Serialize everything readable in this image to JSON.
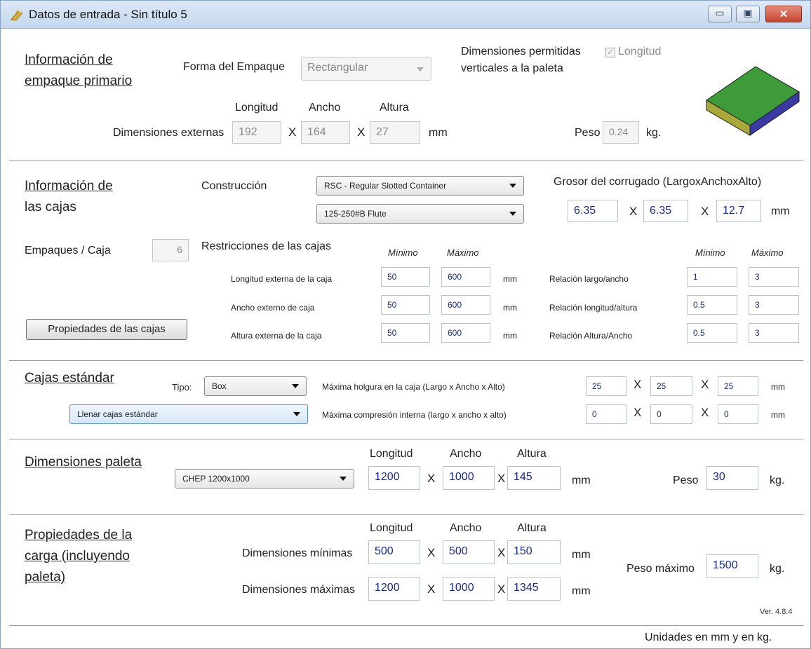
{
  "window": {
    "title": "Datos de entrada - Sin título 5",
    "controls": {
      "minimize": "▭",
      "maximize": "▣",
      "close": "✕"
    }
  },
  "primary": {
    "title_line1": "Información de",
    "title_line2": "empaque primario",
    "shape_label": "Forma del Empaque",
    "shape_value": "Rectangular",
    "vertical_label_1": "Dimensiones permitidas",
    "vertical_label_2": "verticales a la paleta",
    "check_label": "Longitud",
    "check_mark": "✓",
    "col_length": "Longitud",
    "col_width": "Ancho",
    "col_height": "Altura",
    "dims_label": "Dimensiones externas",
    "length": "192",
    "width": "164",
    "height": "27",
    "x": "X",
    "unit_mm": "mm",
    "weight_label": "Peso",
    "weight": "0.24",
    "unit_kg": "kg."
  },
  "boxes": {
    "title_line1": "Información de",
    "title_line2": "las cajas",
    "construction_label": "Construcción",
    "construction_value": "RSC - Regular Slotted Container",
    "flute_value": "125-250#B Flute",
    "thickness_label": "Grosor del corrugado (LargoxAnchoxAlto)",
    "thickness": [
      "6.35",
      "6.35",
      "12.7"
    ],
    "x": "X",
    "unit_mm": "mm",
    "packs_label": "Empaques / Caja",
    "packs_value": "6",
    "restrictions_label": "Restricciones de las cajas",
    "min_label": "Mínimo",
    "max_label": "Máximo",
    "rows": [
      {
        "label": "Longitud externa de la caja",
        "min": "50",
        "max": "600",
        "unit": "mm"
      },
      {
        "label": "Ancho externo de caja",
        "min": "50",
        "max": "600",
        "unit": "mm"
      },
      {
        "label": "Altura externa de la caja",
        "min": "50",
        "max": "600",
        "unit": "mm"
      }
    ],
    "ratios": [
      {
        "label": "Relación largo/ancho",
        "min": "1",
        "max": "3"
      },
      {
        "label": "Relación longitud/altura",
        "min": "0.5",
        "max": "3"
      },
      {
        "label": "Relación Altura/Ancho",
        "min": "0.5",
        "max": "3"
      }
    ],
    "properties_button": "Propiedades de las cajas"
  },
  "standard": {
    "title": "Cajas estándar",
    "type_label": "Tipo:",
    "type_value": "Box",
    "fill_value": "Llenar cajas estándar",
    "slack_label": "Máxima holgura en la caja (Largo x Ancho x Alto)",
    "slack": [
      "25",
      "25",
      "25"
    ],
    "compression_label": "Máxima compresión interna (largo x ancho x alto)",
    "compression": [
      "0",
      "0",
      "0"
    ],
    "x": "X",
    "unit_mm": "mm"
  },
  "pallet": {
    "title": "Dimensiones paleta",
    "type_value": "CHEP 1200x1000",
    "col_length": "Longitud",
    "col_width": "Ancho",
    "col_height": "Altura",
    "length": "1200",
    "width": "1000",
    "height": "145",
    "x": "X",
    "unit_mm": "mm",
    "weight_label": "Peso",
    "weight": "30",
    "unit_kg": "kg."
  },
  "load": {
    "title_line1": "Propiedades de la",
    "title_line2": "carga (incluyendo",
    "title_line3": "paleta)",
    "col_length": "Longitud",
    "col_width": "Ancho",
    "col_height": "Altura",
    "min_label": "Dimensiones mínimas",
    "min": [
      "500",
      "500",
      "150"
    ],
    "max_label": "Dimensiones máximas",
    "max": [
      "1200",
      "1000",
      "1345"
    ],
    "x": "X",
    "unit_mm": "mm",
    "max_weight_label": "Peso máximo",
    "max_weight": "1500",
    "unit_kg": "kg.",
    "version": "Ver. 4.8.4"
  },
  "footer": {
    "units_note": "Unidades en mm y en kg."
  },
  "colors": {
    "box_top": "#3d9b3a",
    "box_front": "#a9a83a",
    "box_side": "#3a3aa5",
    "value_text": "#1a2b8c"
  }
}
